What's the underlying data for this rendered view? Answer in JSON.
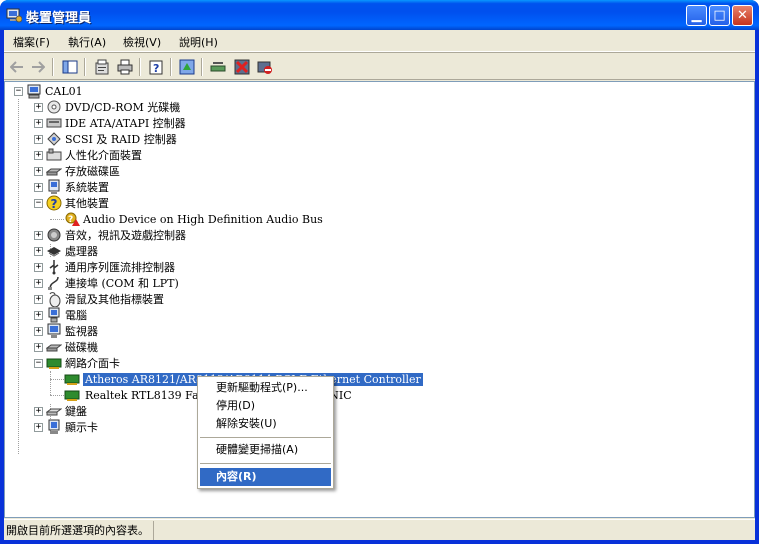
{
  "window": {
    "title": "裝置管理員"
  },
  "menu": [
    "檔案(F)",
    "執行(A)",
    "檢視(V)",
    "說明(H)"
  ],
  "toolbar_icons": [
    "back-arrow-icon",
    "forward-arrow-icon",
    "show-hide-tree-icon",
    "properties-icon",
    "print-icon",
    "help-icon",
    "update-driver-icon",
    "scan-hardware-icon",
    "uninstall-icon",
    "disable-icon"
  ],
  "tree": {
    "root": "CAL01",
    "categories": [
      {
        "label": "DVD/CD-ROM 光碟機",
        "icon": "dvd-icon"
      },
      {
        "label": "IDE ATA/ATAPI 控制器",
        "icon": "ide-icon"
      },
      {
        "label": "SCSI 及 RAID 控制器",
        "icon": "scsi-icon"
      },
      {
        "label": "人性化介面裝置",
        "icon": "hid-icon"
      },
      {
        "label": "存放磁碟區",
        "icon": "storage-icon"
      },
      {
        "label": "系統裝置",
        "icon": "system-icon"
      },
      {
        "label": "其他裝置",
        "icon": "unknown-device-icon",
        "expanded": true,
        "children": [
          "Audio Device on High Definition Audio Bus"
        ]
      },
      {
        "label": "音效，視訊及遊戲控制器",
        "icon": "sound-icon"
      },
      {
        "label": "處理器",
        "icon": "processor-icon"
      },
      {
        "label": "通用序列匯流排控制器",
        "icon": "usb-icon"
      },
      {
        "label": "連接埠 (COM 和 LPT)",
        "icon": "port-icon"
      },
      {
        "label": "滑鼠及其他指標裝置",
        "icon": "mouse-icon"
      },
      {
        "label": "電腦",
        "icon": "computer-icon"
      },
      {
        "label": "監視器",
        "icon": "monitor-icon"
      },
      {
        "label": "磁碟機",
        "icon": "disk-icon"
      },
      {
        "label": "網路介面卡",
        "icon": "network-card-icon",
        "expanded": true,
        "children": [
          "Atheros AR8121/AR8113/AR8114 PCI-E Ethernet Controller",
          "Realtek RTL8139 Family PCI Fast Ethernet NIC"
        ]
      },
      {
        "label": "鍵盤",
        "icon": "keyboard-icon"
      },
      {
        "label": "顯示卡",
        "icon": "display-adapter-icon"
      }
    ]
  },
  "context_menu": {
    "items": [
      "更新驅動程式(P)...",
      "停用(D)",
      "解除安裝(U)",
      "硬體變更掃描(A)",
      "內容(R)"
    ],
    "highlighted": "內容(R)"
  },
  "status": {
    "text": "開啟目前所選選項的內容表。"
  },
  "colors": {
    "selection": "#316ac5",
    "titlebar": "#0054e3",
    "face": "#ece9d8"
  }
}
